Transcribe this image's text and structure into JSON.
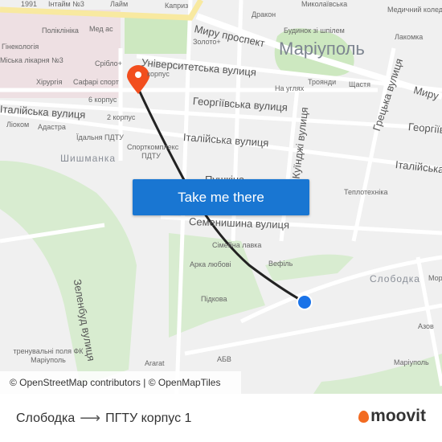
{
  "map": {
    "city": "Маріуполь",
    "districts": [
      "Шишманка",
      "Слободка"
    ],
    "streets": [
      "Миру проспект",
      "Університетська вулиця",
      "Георгіївська вулиця",
      "Італійська вулиця",
      "Італійська вулиця",
      "Георгіївська вулиця",
      "Італійська вулиця",
      "Куїнджі вулиця",
      "Грецька вулиця",
      "Семенишина вулиця",
      "Зеленбуд вулиця",
      "Миру",
      "Пушкіна"
    ],
    "pois": [
      "1991",
      "Інтайм №3",
      "Лайм",
      "Каприз",
      "Поліклініка",
      "Мед ас",
      "Гінекологія",
      "Міська лікарня №3",
      "Срібло+",
      "Хірургія",
      "Сафарі спорт",
      "6 корпус",
      "2 корпус",
      "Ліоком",
      "Адастра",
      "Їдальня ПДТУ",
      "Спорткомплекс ПДТУ",
      "Золото+",
      "корпус",
      "Дракон",
      "Миколаївська",
      "Медичний коледж",
      "Будинок зі шпілем",
      "Лакомка",
      "Троянди",
      "Щастя",
      "На углях",
      "Теплотехніка",
      "Сімейна лавка",
      "Арка любові",
      "Вефіль",
      "Підкова",
      "Ararat",
      "АБВ",
      "Азов",
      "Маріуполь",
      "Мор",
      "тренувальні поля ФК Маріуполь"
    ],
    "cta_label": "Take me there",
    "attribution": "© OpenStreetMap contributors | © OpenMapTiles",
    "colors": {
      "cta": "#1976d2",
      "destination_marker": "#f24e1e",
      "origin_dot": "#1a73e8",
      "route": "#222222"
    }
  },
  "footer": {
    "origin": "Слободка",
    "arrow": "⟶",
    "destination": "ПГТУ корпус 1",
    "logo": "moovit"
  }
}
